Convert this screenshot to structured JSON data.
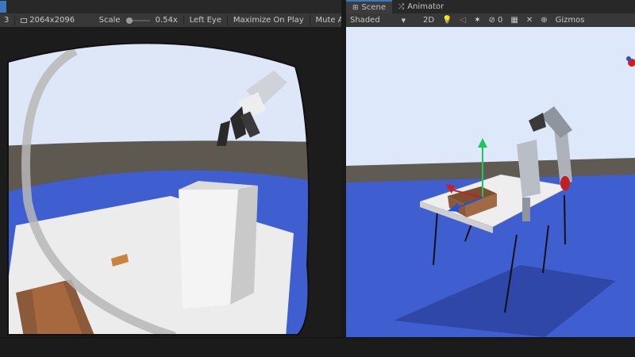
{
  "game_toolbar": {
    "display_index": "3",
    "resolution": "2064x2096",
    "scale_label": "Scale",
    "scale_value": "0.54x",
    "eye": "Left Eye",
    "maximize": "Maximize On Play",
    "mute": "Mute Au"
  },
  "scene_tabs": [
    {
      "label": "Scene"
    },
    {
      "label": "Animator"
    }
  ],
  "scene_toolbar": {
    "shading": "Shaded",
    "mode_2d": "2D",
    "hidden_count": "0",
    "gizmos": "Gizmos"
  },
  "colors": {
    "toolbar_bg": "#383838",
    "sky": "#dde8fb",
    "ground": "#3f5fd0",
    "horizon": "#5f5a52",
    "table_top": "#eaeaea",
    "box_wood": "#8a5a3a",
    "gizmo_y": "#21c65a",
    "gizmo_x": "#c82020",
    "gizmo_z": "#2050e0"
  },
  "icons": [
    "scene-grid-icon",
    "animator-icon",
    "lightbulb-icon",
    "audio-icon",
    "effects-icon",
    "visibility-icon",
    "camera-icon",
    "tools-icon",
    "gizmos-icon",
    "orientation-gizmo-icon"
  ]
}
